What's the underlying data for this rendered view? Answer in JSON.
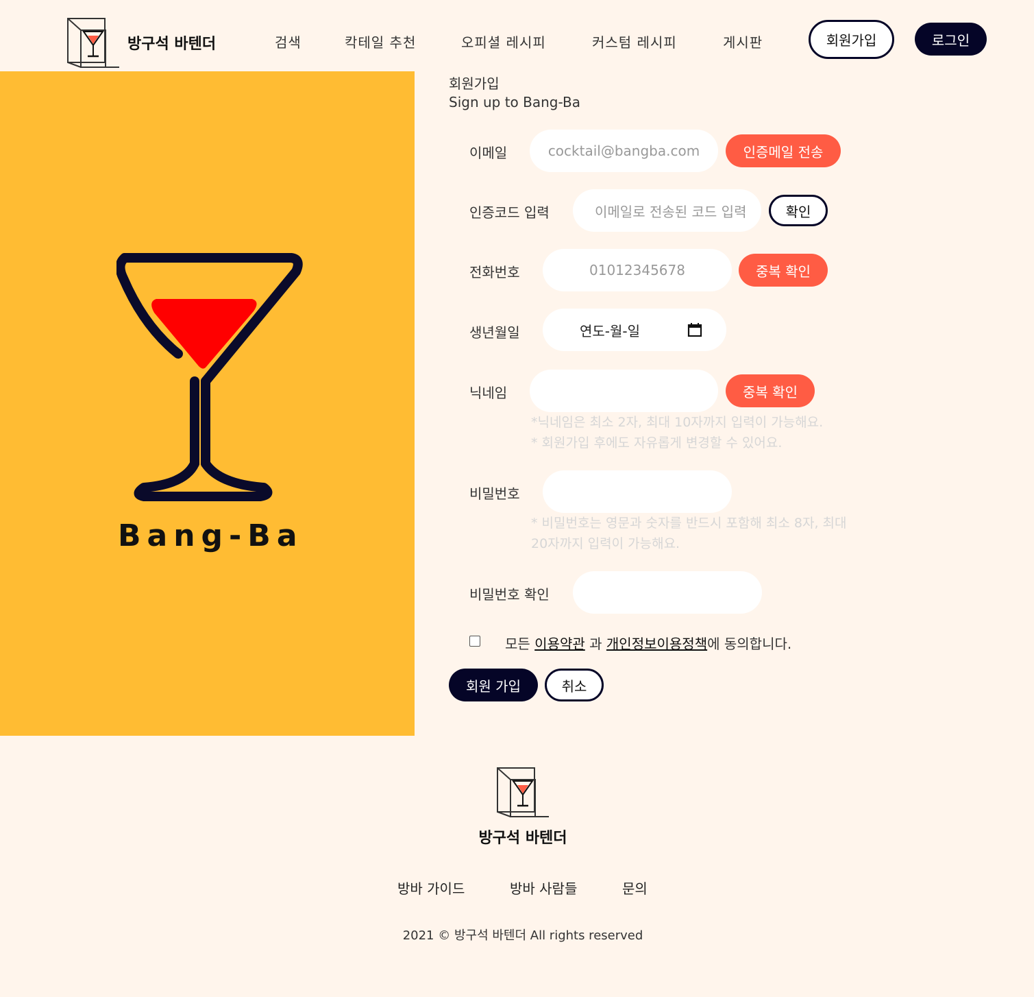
{
  "header": {
    "brand": "방구석 바텐더",
    "nav": [
      "검색",
      "칵테일 추천",
      "오피셜 레시피",
      "커스텀 레시피",
      "게시판"
    ],
    "signup_label": "회원가입",
    "login_label": "로그인"
  },
  "panel": {
    "wordmark": "Bang-Ba"
  },
  "form": {
    "title": "회원가입",
    "subtitle": "Sign up to Bang-Ba",
    "email": {
      "label": "이메일",
      "placeholder": "cocktail@bangba.com",
      "button": "인증메일 전송"
    },
    "code": {
      "label": "인증코드 입력",
      "placeholder": "이메일로 전송된 코드 입력",
      "button": "확인"
    },
    "phone": {
      "label": "전화번호",
      "placeholder": "01012345678",
      "button": "중복 확인"
    },
    "birth": {
      "label": "생년월일",
      "placeholder": "연도-월-일"
    },
    "nickname": {
      "label": "닉네임",
      "button": "중복 확인",
      "hint1": "*닉네임은 최소 2자, 최대 10자까지 입력이 가능해요.",
      "hint2": "* 회원가입 후에도 자유롭게 변경할 수 있어요."
    },
    "password": {
      "label": "비밀번호",
      "hint": "* 비밀번호는 영문과 숫자를 반드시 포함해 최소 8자, 최대 20자까지 입력이 가능해요."
    },
    "password_confirm": {
      "label": "비밀번호 확인"
    },
    "agree": {
      "prefix": "모든",
      "terms": "이용약관",
      "mid": "과",
      "privacy": "개인정보이용정책",
      "suffix": "에 동의합니다."
    },
    "submit_label": "회원 가입",
    "cancel_label": "취소"
  },
  "footer": {
    "brand": "방구석 바텐더",
    "links": [
      "방바 가이드",
      "방바 사람들",
      "문의"
    ],
    "copyright": "2021 © 방구석 바텐더 All rights reserved"
  },
  "colors": {
    "background": "#fff5ec",
    "panel": "#ffbc33",
    "accent": "#ff5c44",
    "navy": "#050527"
  }
}
